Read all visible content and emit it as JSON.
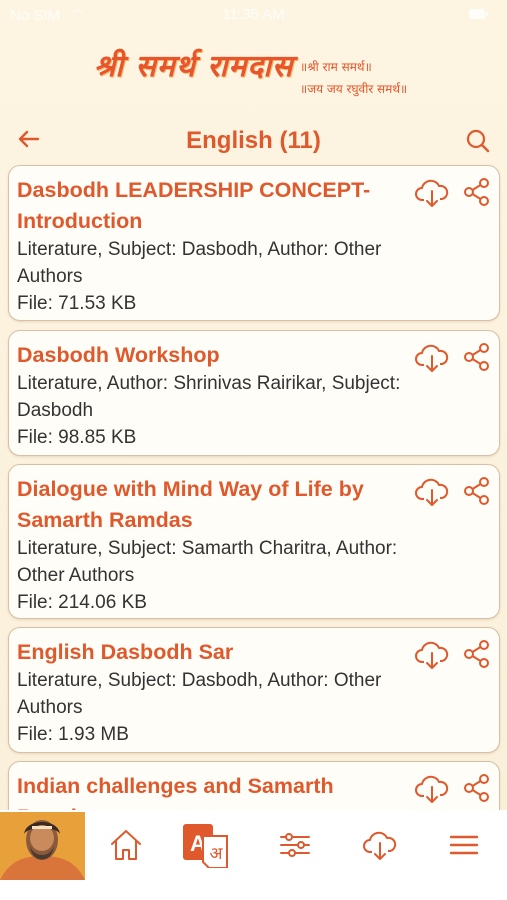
{
  "status_bar": {
    "carrier": "No SIM",
    "time": "11:35 AM"
  },
  "logo": {
    "main": "श्री समर्थ रामदास",
    "line1": "॥श्री राम समर्थ॥",
    "line2": "॥जय जय रघुवीर समर्थ॥"
  },
  "header": {
    "title": "English (11)",
    "back_icon": "arrow-left-icon",
    "search_icon": "search-icon"
  },
  "colors": {
    "accent": "#e0592c",
    "background": "#fbf3e2",
    "card_border": "#d7c0a8"
  },
  "items": [
    {
      "title": "Dasbodh LEADERSHIP CONCEPT- Introduction",
      "meta": "Literature, Subject: Dasbodh, Author: Other Authors",
      "file": "File: 71.53 KB"
    },
    {
      "title": "Dasbodh Workshop",
      "meta": "Literature, Author: Shrinivas Rairikar, Subject: Dasbodh",
      "file": "File: 98.85 KB"
    },
    {
      "title": "Dialogue with Mind Way of Life by Samarth Ramdas",
      "meta": "Literature, Subject: Samarth Charitra, Author: Other Authors",
      "file": "File: 214.06 KB"
    },
    {
      "title": "English Dasbodh Sar",
      "meta": "Literature, Subject: Dasbodh, Author: Other Authors",
      "file": "File: 1.93 MB"
    },
    {
      "title": "Indian challenges and Samarth Ramdas",
      "meta": "",
      "file": ""
    }
  ],
  "bottom_nav": {
    "items": [
      "home-icon",
      "language-icon",
      "filter-sliders-icon",
      "download-cloud-icon",
      "menu-icon"
    ],
    "active": "language-icon"
  }
}
